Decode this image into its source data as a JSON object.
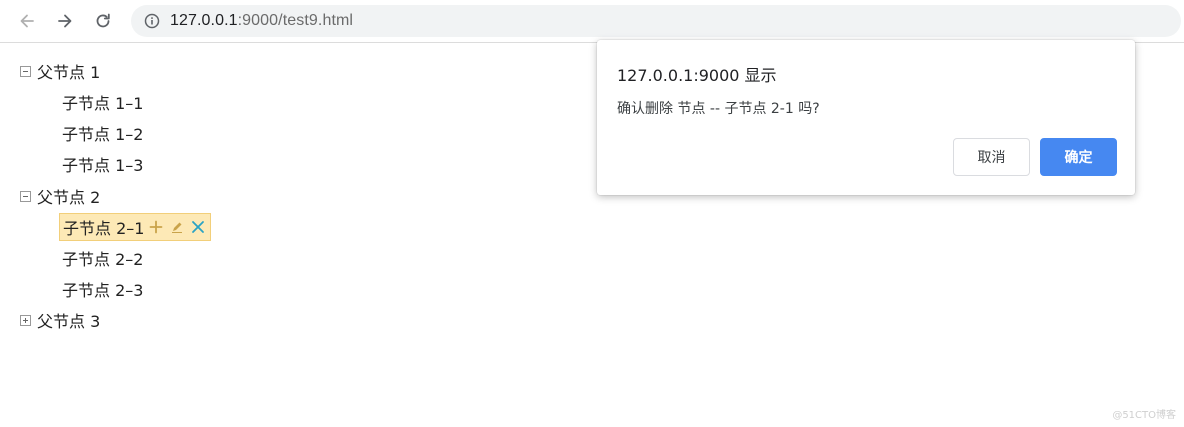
{
  "browser": {
    "url_host": "127.0.0.1",
    "url_path": ":9000/test9.html"
  },
  "tree": {
    "parents": [
      {
        "label": "父节点 1",
        "expanded": true,
        "children": [
          "子节点 1–1",
          "子节点 1–2",
          "子节点 1–3"
        ]
      },
      {
        "label": "父节点 2",
        "expanded": true,
        "children": [
          "子节点 2–1",
          "子节点 2–2",
          "子节点 2–3"
        ]
      },
      {
        "label": "父节点 3",
        "expanded": false,
        "children": []
      }
    ],
    "selected_child": "子节点 2–1",
    "colors": {
      "selected_bg": "#fde9b6",
      "selected_border": "#f2cf7a",
      "add_icon": "#c9a34a",
      "remove_icon": "#2aa3c4"
    }
  },
  "dialog": {
    "title": "127.0.0.1:9000 显示",
    "message": "确认删除 节点 -- 子节点 2-1 吗?",
    "cancel_label": "取消",
    "ok_label": "确定",
    "colors": {
      "ok_bg": "#4688f1"
    }
  },
  "watermark": "@51CTO博客"
}
